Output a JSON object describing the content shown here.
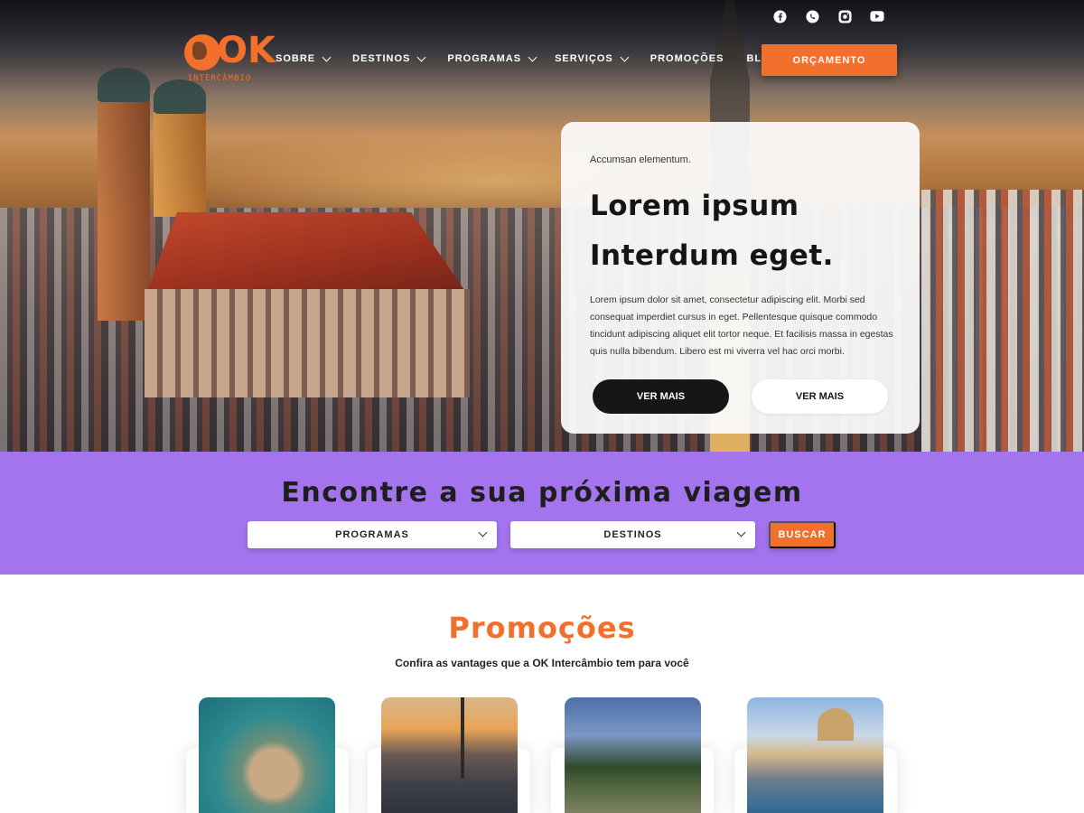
{
  "brand": {
    "logo_letters": "OK",
    "logo_sub": "INTERCÂMBIO",
    "accent_color": "#f36f2c",
    "band_color": "#a474ee"
  },
  "socials": [
    {
      "icon": "facebook-icon"
    },
    {
      "icon": "whatsapp-icon"
    },
    {
      "icon": "instagram-icon"
    },
    {
      "icon": "youtube-icon"
    }
  ],
  "nav": {
    "items": [
      {
        "label": "SOBRE",
        "has_dropdown": true
      },
      {
        "label": "DESTINOS",
        "has_dropdown": true
      },
      {
        "label": "PROGRAMAS",
        "has_dropdown": true
      },
      {
        "label": "SERVIÇOS",
        "has_dropdown": true
      },
      {
        "label": "PROMOÇÕES",
        "has_dropdown": false
      },
      {
        "label": "BLOG",
        "has_dropdown": false
      }
    ],
    "cta_label": "ORÇAMENTO"
  },
  "hero": {
    "kicker": "Accumsan elementum.",
    "headline_line1": "Lorem ipsum",
    "headline_line2": "Interdum eget.",
    "body": "Lorem ipsum dolor sit amet, consectetur adipiscing elit. Morbi sed consequat imperdiet cursus in eget. Pellentesque quisque commodo tincidunt adipiscing aliquet elit tortor neque. Et facilisis massa in egestas quis nulla bibendum. Libero est mi viverra vel hac orci morbi.",
    "button_primary": "VER MAIS",
    "button_secondary": "VER MAIS"
  },
  "search": {
    "title": "Encontre a sua próxima viagem",
    "select_programas": "PROGRAMAS",
    "select_destinos": "DESTINOS",
    "button": "BUSCAR"
  },
  "promos": {
    "title": "Promoções",
    "subtitle": "Confira as vantages que a OK Intercâmbio tem para você",
    "cards": [
      {
        "image": "coastal-city-aerial"
      },
      {
        "image": "city-tower-sunset"
      },
      {
        "image": "garden-ruins"
      },
      {
        "image": "harbor-boats-church"
      }
    ]
  }
}
